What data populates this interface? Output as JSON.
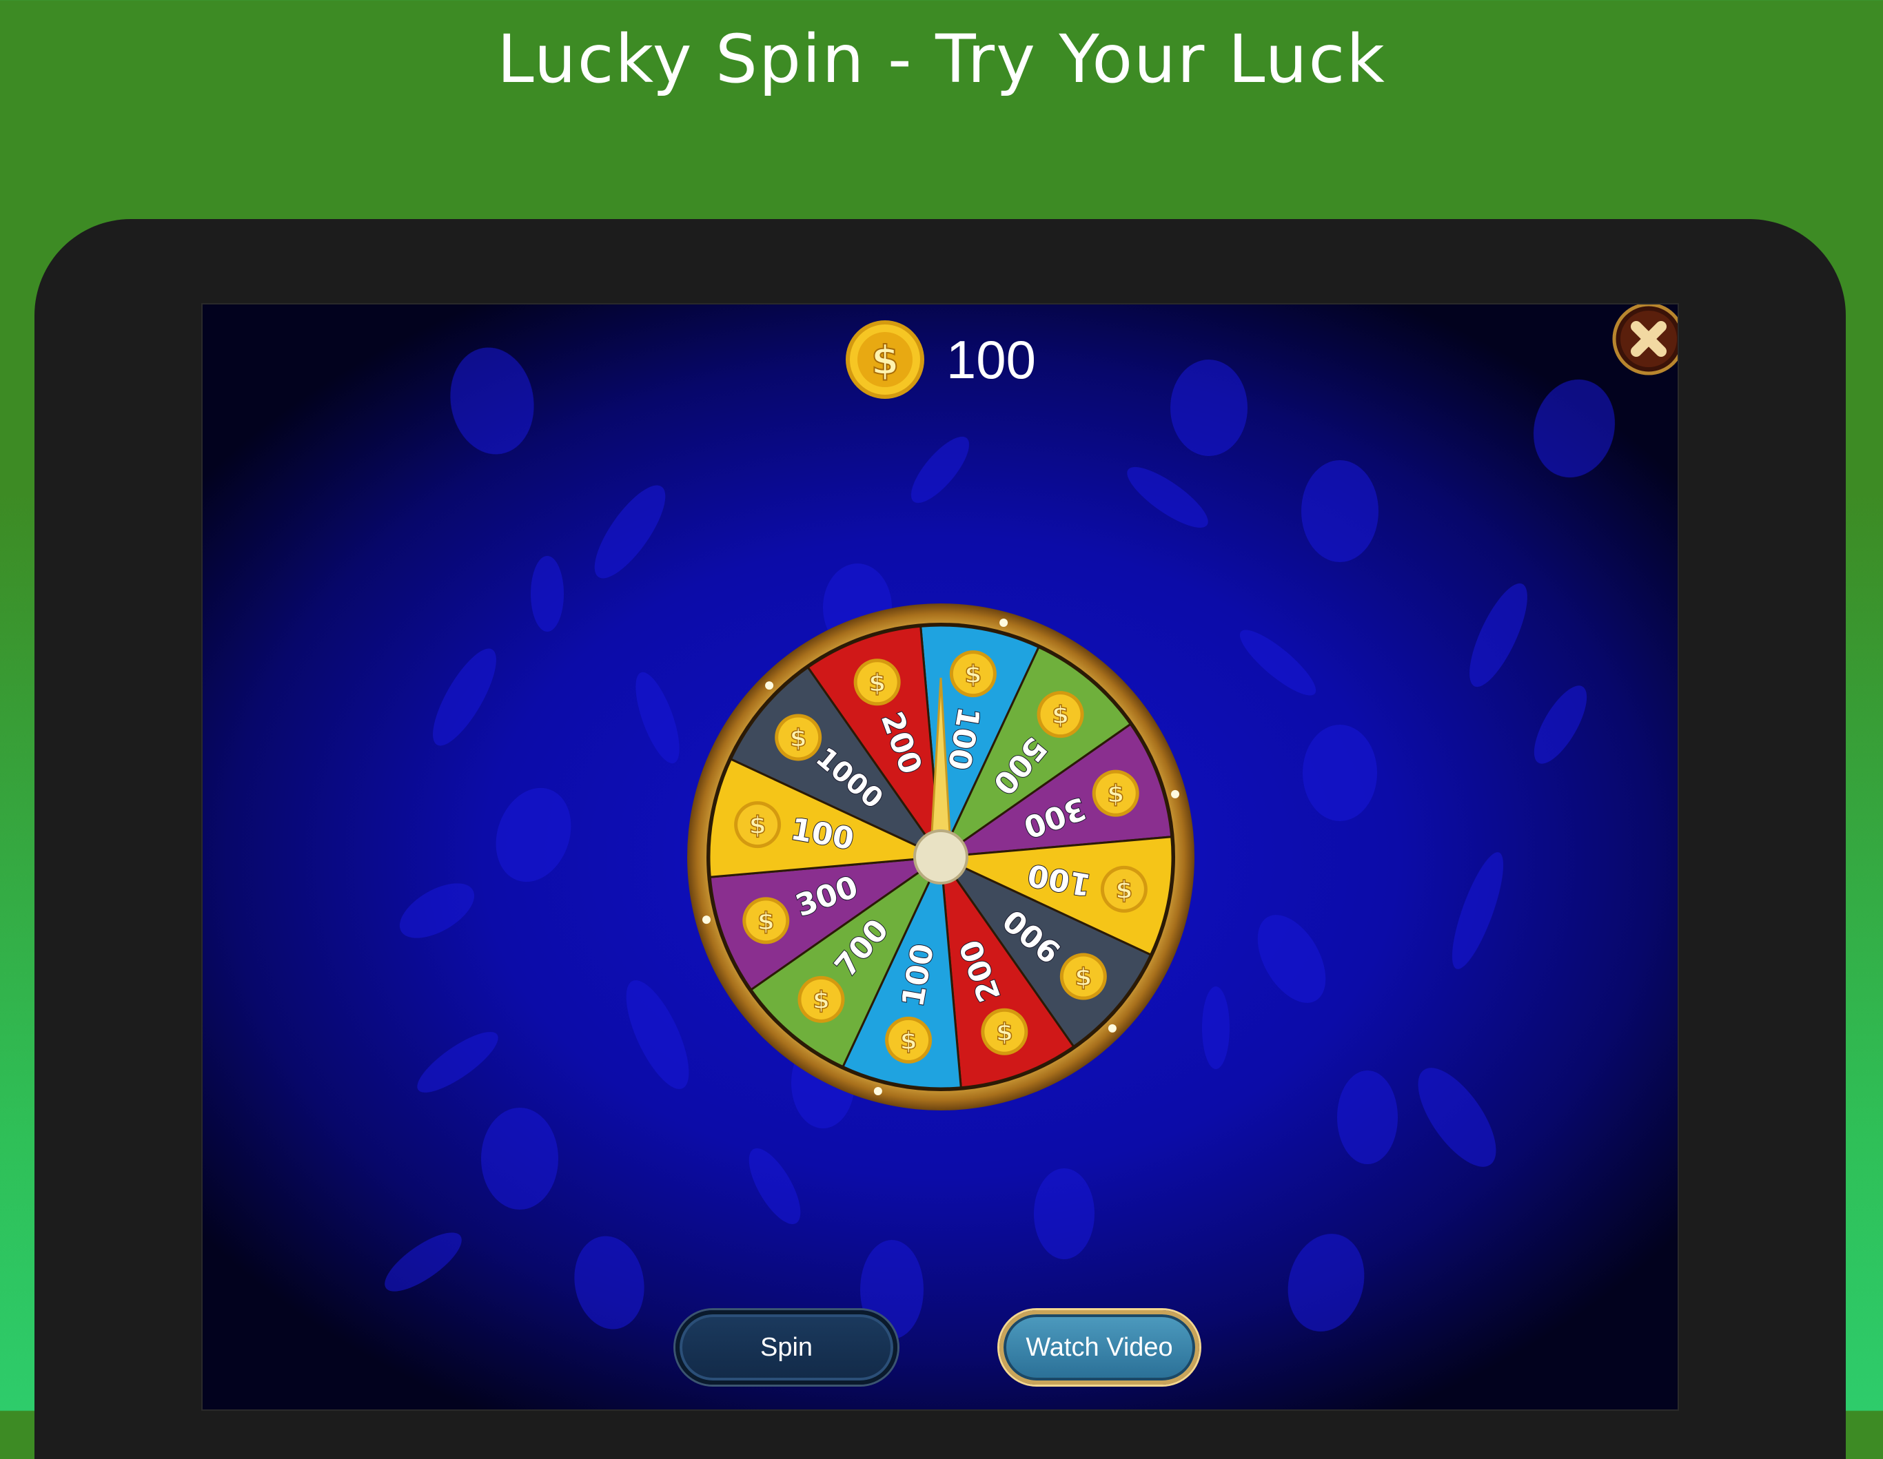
{
  "page": {
    "title": "Lucky Spin - Try Your Luck"
  },
  "header": {
    "coin_icon": "dollar-coin-icon",
    "balance": "100",
    "close_icon": "close-icon"
  },
  "wheel": {
    "pointer_icon": "wheel-pointer-icon",
    "segments": [
      {
        "label": "100",
        "color": "#1fa3e0"
      },
      {
        "label": "500",
        "color": "#6fb03c"
      },
      {
        "label": "300",
        "color": "#8a2f8f"
      },
      {
        "label": "100",
        "color": "#f5c518"
      },
      {
        "label": "900",
        "color": "#3e4a5c"
      },
      {
        "label": "200",
        "color": "#d01818"
      },
      {
        "label": "100",
        "color": "#1fa3e0"
      },
      {
        "label": "700",
        "color": "#6fb03c"
      },
      {
        "label": "300",
        "color": "#8a2f8f"
      },
      {
        "label": "100",
        "color": "#f5c518"
      },
      {
        "label": "1000",
        "color": "#3e4a5c"
      },
      {
        "label": "200",
        "color": "#d01818"
      }
    ]
  },
  "actions": {
    "spin_label": "Spin",
    "watch_video_label": "Watch Video"
  },
  "colors": {
    "background_top": "#3d8b24",
    "background_bottom": "#2ecc6b",
    "screen_blue": "#1010c8",
    "rim_gold": "#c9922a"
  }
}
